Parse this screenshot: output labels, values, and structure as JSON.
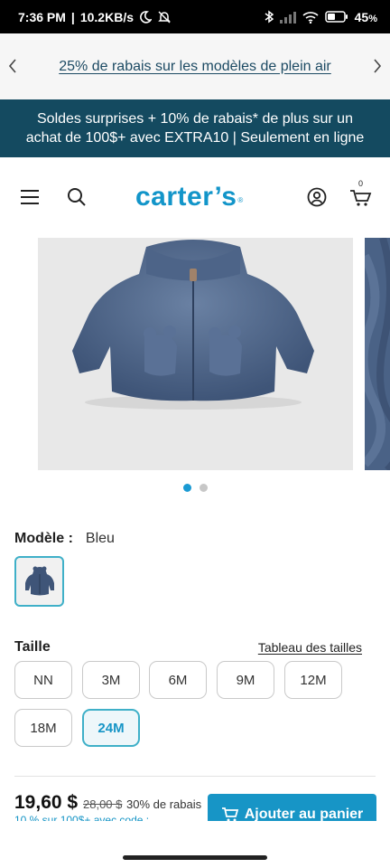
{
  "status_bar": {
    "time": "7:36 PM",
    "net_speed": "10.2KB/s",
    "battery": "45"
  },
  "promo": {
    "text": "25% de rabais sur les modèles de plein air"
  },
  "sale_banner": {
    "line1": "Soldes surprises + 10% de rabais* de plus sur un",
    "line2": "achat de 100$+ avec EXTRA10 | Seulement en ligne"
  },
  "header": {
    "logo_text": "carter’s",
    "logo_mark": "®",
    "cart_count": "0"
  },
  "gallery": {
    "slide_count": 2,
    "active_slide": 1
  },
  "product": {
    "model_label": "Modèle :",
    "model_value": "Bleu",
    "size_heading": "Taille",
    "size_chart_link": "Tableau des tailles",
    "sizes": [
      "NN",
      "3M",
      "6M",
      "9M",
      "12M",
      "18M",
      "24M"
    ],
    "selected_size": "24M"
  },
  "price": {
    "current": "19,60 $",
    "original": "28,00 $",
    "discount": "30% de rabais",
    "note": "10 % sur 100$+ avec code :"
  },
  "actions": {
    "add_to_cart": "Ajouter au panier"
  },
  "colors": {
    "brand_blue": "#1295c9",
    "banner_teal": "#144a60",
    "selected_border": "#3fb0c8"
  }
}
